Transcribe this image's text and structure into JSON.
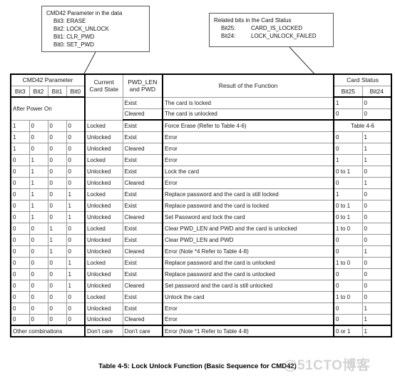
{
  "callouts": {
    "cmd42": {
      "title": "CMD42 Parameter in the data",
      "lines": [
        {
          "bit": "Bit3:",
          "value": "ERASE"
        },
        {
          "bit": "Bit2:",
          "value": "LOCK_UNLOCK"
        },
        {
          "bit": "Bit1:",
          "value": "CLR_PWD"
        },
        {
          "bit": "Bit0:",
          "value": "SET_PWD"
        }
      ]
    },
    "card_status": {
      "title": "Related bits in the Card Status",
      "lines": [
        {
          "bit": "Bit25:",
          "value": "CARD_IS_LOCKED"
        },
        {
          "bit": "Bit24:",
          "value": "LOCK_UNLOCK_FAILED"
        }
      ]
    }
  },
  "table": {
    "headers": {
      "cmd42_parameter": "CMD42 Parameter",
      "current_card_state": "Current\nCard State",
      "current_card_state_l1": "Current",
      "current_card_state_l2": "Card State",
      "pwd_len_and_pwd_l1": "PWD_LEN",
      "pwd_len_and_pwd_l2": "and PWD",
      "result_of_the_function": "Result of the Function",
      "card_status": "Card Status",
      "bit3": "Bit3",
      "bit2": "Bit2",
      "bit1": "Bit1",
      "bit0": "Bit0",
      "bit25": "Bit25",
      "bit24": "Bit24"
    },
    "power_on": {
      "label": "After Power On",
      "rows": [
        {
          "pwd": "Exist",
          "result": "The card is locked",
          "bit25": "1",
          "bit24": "0"
        },
        {
          "pwd": "Cleared",
          "result": "The card is unlocked",
          "bit25": "0",
          "bit24": "0"
        }
      ]
    },
    "groups": [
      {
        "rows": [
          {
            "bit3": "1",
            "bit2": "0",
            "bit1": "0",
            "bit0": "0",
            "state": "Locked",
            "pwd": "Exist",
            "result": "Force Erase (Refer to Table 4-6)",
            "merged_status": "Table 4-6"
          },
          {
            "bit3": "1",
            "bit2": "0",
            "bit1": "0",
            "bit0": "0",
            "state": "Unlocked",
            "pwd": "Exist",
            "result": "Error",
            "bit25": "0",
            "bit24": "1"
          },
          {
            "bit3": "1",
            "bit2": "0",
            "bit1": "0",
            "bit0": "0",
            "state": "Unlocked",
            "pwd": "Cleared",
            "result": "Error",
            "bit25": "0",
            "bit24": "1"
          }
        ]
      },
      {
        "rows": [
          {
            "bit3": "0",
            "bit2": "1",
            "bit1": "0",
            "bit0": "0",
            "state": "Locked",
            "pwd": "Exist",
            "result": "Error",
            "bit25": "1",
            "bit24": "1"
          },
          {
            "bit3": "0",
            "bit2": "1",
            "bit1": "0",
            "bit0": "0",
            "state": "Unlocked",
            "pwd": "Exist",
            "result": "Lock the card",
            "bit25": "0 to 1",
            "bit24": "0"
          },
          {
            "bit3": "0",
            "bit2": "1",
            "bit1": "0",
            "bit0": "0",
            "state": "Unlocked",
            "pwd": "Cleared",
            "result": "Error",
            "bit25": "0",
            "bit24": "1"
          }
        ]
      },
      {
        "rows": [
          {
            "bit3": "0",
            "bit2": "1",
            "bit1": "0",
            "bit0": "1",
            "state": "Locked",
            "pwd": "Exist",
            "result": "Replace password and the card is still locked",
            "bit25": "1",
            "bit24": "0"
          },
          {
            "bit3": "0",
            "bit2": "1",
            "bit1": "0",
            "bit0": "1",
            "state": "Unlocked",
            "pwd": "Exist",
            "result": "Replace password and the card is locked",
            "bit25": "0 to 1",
            "bit24": "0"
          },
          {
            "bit3": "0",
            "bit2": "1",
            "bit1": "0",
            "bit0": "1",
            "state": "Unlocked",
            "pwd": "Cleared",
            "result": "Set Password and lock the card",
            "bit25": "0 to 1",
            "bit24": "0"
          }
        ]
      },
      {
        "rows": [
          {
            "bit3": "0",
            "bit2": "0",
            "bit1": "1",
            "bit0": "0",
            "state": "Locked",
            "pwd": "Exist",
            "result": "Clear PWD_LEN and PWD and the card is unlocked",
            "bit25": "1 to 0",
            "bit24": "0"
          },
          {
            "bit3": "0",
            "bit2": "0",
            "bit1": "1",
            "bit0": "0",
            "state": "Unlocked",
            "pwd": "Exist",
            "result": "Clear PWD_LEN and PWD",
            "bit25": "0",
            "bit24": "0"
          },
          {
            "bit3": "0",
            "bit2": "0",
            "bit1": "1",
            "bit0": "0",
            "state": "Unlocked",
            "pwd": "Cleared",
            "result": "Error (Note *4  Refer to Table 4-8)",
            "bit25": "0",
            "bit24": "1"
          }
        ]
      },
      {
        "rows": [
          {
            "bit3": "0",
            "bit2": "0",
            "bit1": "0",
            "bit0": "1",
            "state": "Locked",
            "pwd": "Exist",
            "result": "Replace password and the card is unlocked",
            "bit25": "1 to 0",
            "bit24": "0"
          },
          {
            "bit3": "0",
            "bit2": "0",
            "bit1": "0",
            "bit0": "1",
            "state": "Unlocked",
            "pwd": "Exist",
            "result": "Replace password and the card is unlocked",
            "bit25": "0",
            "bit24": "0"
          },
          {
            "bit3": "0",
            "bit2": "0",
            "bit1": "0",
            "bit0": "1",
            "state": "Unlocked",
            "pwd": "Cleared",
            "result": "Set password and the card is still unlocked",
            "bit25": "0",
            "bit24": "0"
          }
        ]
      },
      {
        "rows": [
          {
            "bit3": "0",
            "bit2": "0",
            "bit1": "0",
            "bit0": "0",
            "state": "Locked",
            "pwd": "Exist",
            "result": "Unlock the card",
            "bit25": "1 to 0",
            "bit24": "0"
          },
          {
            "bit3": "0",
            "bit2": "0",
            "bit1": "0",
            "bit0": "0",
            "state": "Unlocked",
            "pwd": "Exist",
            "result": "Error",
            "bit25": "0",
            "bit24": "1"
          },
          {
            "bit3": "0",
            "bit2": "0",
            "bit1": "0",
            "bit0": "0",
            "state": "Unlocked",
            "pwd": "Cleared",
            "result": "Error",
            "bit25": "0",
            "bit24": "1"
          }
        ]
      }
    ],
    "other": {
      "label": "Other combinations",
      "state": "Don't care",
      "pwd": "Don't care",
      "result": "Error (Note *1  Refer to Table 4-8)",
      "bit25": "0 or 1",
      "bit24": "1"
    }
  },
  "caption": "Table 4-5: Lock Unlock Function (Basic Sequence for CMD42)",
  "watermark": "@51CTO博客"
}
